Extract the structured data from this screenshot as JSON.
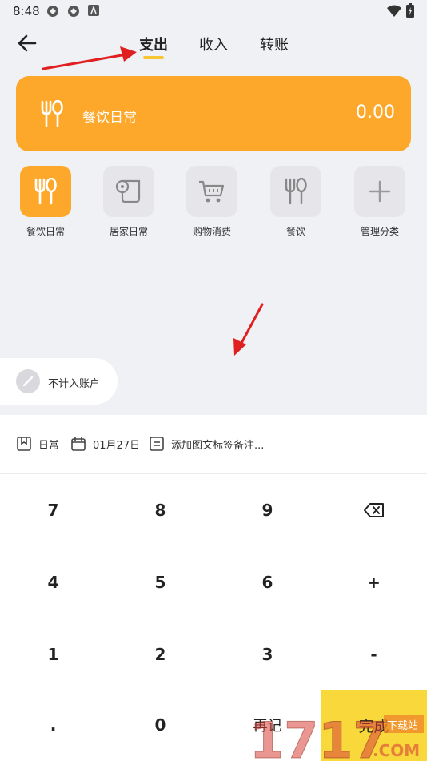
{
  "status_bar": {
    "time": "8:48"
  },
  "tabs": [
    {
      "label": "支出",
      "active": true
    },
    {
      "label": "收入",
      "active": false
    },
    {
      "label": "转账",
      "active": false
    }
  ],
  "summary_card": {
    "category": "餐饮日常",
    "amount": "0.00",
    "color": "#fda82b"
  },
  "categories": [
    {
      "label": "餐饮日常",
      "icon": "fork-spoon-icon",
      "active": true
    },
    {
      "label": "居家日常",
      "icon": "toilet-paper-icon",
      "active": false
    },
    {
      "label": "购物消费",
      "icon": "shopping-cart-icon",
      "active": false
    },
    {
      "label": "餐饮",
      "icon": "fork-spoon-icon",
      "active": false
    },
    {
      "label": "管理分类",
      "icon": "plus-icon",
      "active": false
    }
  ],
  "account_toggle": {
    "label": "不计入账户"
  },
  "meta": {
    "book": "日常",
    "date": "01月27日",
    "note_placeholder": "添加图文标签备注..."
  },
  "keypad": {
    "rows": [
      [
        "7",
        "8",
        "9",
        "⌫"
      ],
      [
        "4",
        "5",
        "6",
        "+"
      ],
      [
        "1",
        "2",
        "3",
        "-"
      ],
      [
        ".",
        "0",
        "再记",
        "完成"
      ]
    ]
  },
  "watermark": {
    "text": "1717",
    "site": "下载站",
    "domain": ".COM"
  },
  "colors": {
    "accent": "#fda82b",
    "tab_indicator": "#f9c633",
    "done_button": "#f9d83b",
    "annotation_arrow": "#e02020"
  }
}
